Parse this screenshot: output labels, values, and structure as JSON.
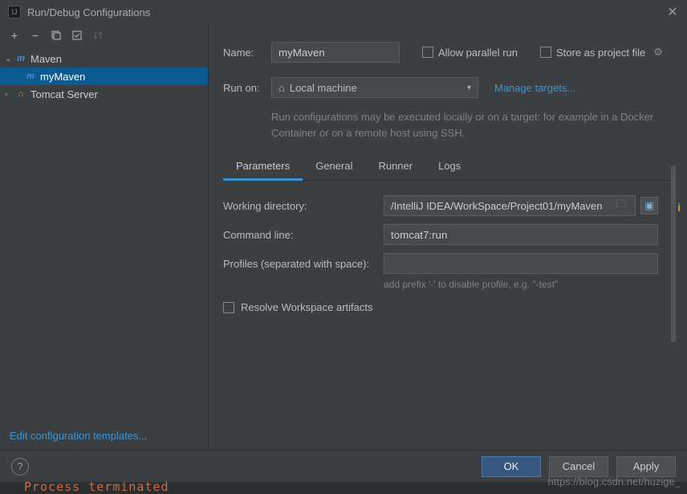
{
  "window": {
    "title": "Run/Debug Configurations"
  },
  "toolbar": {
    "add": "+",
    "remove": "−"
  },
  "tree": {
    "items": [
      {
        "label": "Maven",
        "icon": "m",
        "expanded": true,
        "children": [
          {
            "label": "myMaven",
            "icon": "m",
            "selected": true
          }
        ]
      },
      {
        "label": "Tomcat Server",
        "icon": "⧉",
        "expanded": false
      }
    ]
  },
  "left_footer_link": "Edit configuration templates...",
  "form": {
    "name_label": "Name:",
    "name_value": "myMaven",
    "allow_parallel": "Allow parallel run",
    "store_as_project": "Store as project file",
    "run_on_label": "Run on:",
    "run_on_value": "Local machine",
    "manage_targets": "Manage targets...",
    "hint": "Run configurations may be executed locally or on a target: for example in a Docker Container or on a remote host using SSH."
  },
  "tabs": {
    "items": [
      "Parameters",
      "General",
      "Runner",
      "Logs"
    ],
    "active": 0
  },
  "parameters": {
    "working_dir_label": "Working directory:",
    "working_dir_value": "/IntelliJ IDEA/WorkSpace/Project01/myMaven",
    "command_line_label": "Command line:",
    "command_line_value": "tomcat7:run",
    "profiles_label": "Profiles (separated with space):",
    "profiles_value": "",
    "profiles_hint": "add prefix '-' to disable profile, e.g. \"-test\"",
    "resolve_artifacts": "Resolve Workspace artifacts"
  },
  "buttons": {
    "ok": "OK",
    "cancel": "Cancel",
    "apply": "Apply"
  },
  "terminal": "Process  terminated",
  "watermark": "https://blog.csdn.net/huzige_"
}
